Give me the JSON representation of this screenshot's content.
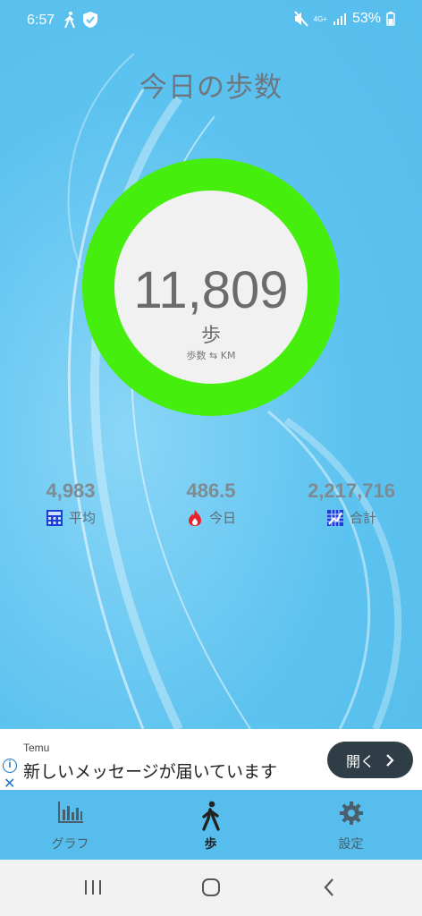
{
  "status_bar": {
    "time": "6:57",
    "battery": "53%",
    "network": "4G+"
  },
  "title": "今日の歩数",
  "steps": {
    "value": "11,809",
    "unit": "歩",
    "toggle_label": "歩数 ⇆ KM",
    "ring_color": "#46ee0e"
  },
  "stats": [
    {
      "value": "4,983",
      "label": "平均",
      "icon": "calculator-icon"
    },
    {
      "value": "486.5",
      "label": "今日",
      "icon": "fire-icon"
    },
    {
      "value": "2,217,716",
      "label": "合計",
      "icon": "grid-chart-icon"
    }
  ],
  "ad": {
    "brand": "Temu",
    "message": "新しいメッセージが届いています",
    "button_label": "開く",
    "info_icon": "i",
    "close_icon": "✕"
  },
  "bottom_nav": [
    {
      "label": "グラフ",
      "icon": "bar-chart-icon"
    },
    {
      "label": "歩",
      "icon": "walking-icon",
      "active": true
    },
    {
      "label": "設定",
      "icon": "gear-icon"
    }
  ]
}
